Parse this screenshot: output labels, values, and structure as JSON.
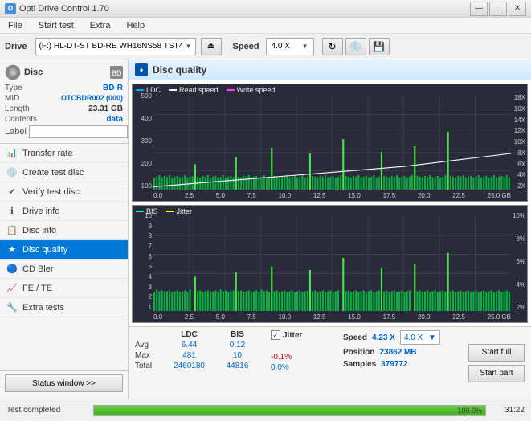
{
  "app": {
    "title": "Opti Drive Control 1.70",
    "icon_label": "O"
  },
  "title_controls": {
    "minimize": "—",
    "maximize": "□",
    "close": "✕"
  },
  "menu": {
    "items": [
      "File",
      "Start test",
      "Extra",
      "Help"
    ]
  },
  "drive_bar": {
    "drive_label": "Drive",
    "drive_value": "(F:)  HL-DT-ST BD-RE  WH16NS58 TST4",
    "speed_label": "Speed",
    "speed_value": "4.0 X"
  },
  "disc": {
    "title": "Disc",
    "type_label": "Type",
    "type_value": "BD-R",
    "mid_label": "MID",
    "mid_value": "OTCBDR002 (000)",
    "length_label": "Length",
    "length_value": "23.31 GB",
    "contents_label": "Contents",
    "contents_value": "data",
    "label_label": "Label"
  },
  "nav": {
    "items": [
      {
        "id": "transfer-rate",
        "label": "Transfer rate",
        "icon": "📊"
      },
      {
        "id": "create-test-disc",
        "label": "Create test disc",
        "icon": "💿"
      },
      {
        "id": "verify-test-disc",
        "label": "Verify test disc",
        "icon": "✔"
      },
      {
        "id": "drive-info",
        "label": "Drive info",
        "icon": "ℹ"
      },
      {
        "id": "disc-info",
        "label": "Disc info",
        "icon": "📋"
      },
      {
        "id": "disc-quality",
        "label": "Disc quality",
        "icon": "★",
        "active": true
      },
      {
        "id": "cd-bler",
        "label": "CD Bler",
        "icon": "🔵"
      },
      {
        "id": "fe-te",
        "label": "FE / TE",
        "icon": "📈"
      },
      {
        "id": "extra-tests",
        "label": "Extra tests",
        "icon": "🔧"
      }
    ]
  },
  "disc_quality": {
    "title": "Disc quality",
    "chart1": {
      "legend": [
        {
          "label": "LDC",
          "color": "#00aaff"
        },
        {
          "label": "Read speed",
          "color": "#ffffff"
        },
        {
          "label": "Write speed",
          "color": "#ff44ff"
        }
      ],
      "y_axis_right": [
        "18X",
        "16X",
        "14X",
        "12X",
        "10X",
        "8X",
        "6X",
        "4X",
        "2X"
      ],
      "y_axis_left": [
        "500",
        "400",
        "300",
        "200",
        "100"
      ],
      "x_axis": [
        "0.0",
        "2.5",
        "5.0",
        "7.5",
        "10.0",
        "12.5",
        "15.0",
        "17.5",
        "20.0",
        "22.5",
        "25.0 GB"
      ]
    },
    "chart2": {
      "legend": [
        {
          "label": "BIS",
          "color": "#00ffaa"
        },
        {
          "label": "Jitter",
          "color": "#ffff00"
        }
      ],
      "y_axis_right": [
        "10%",
        "8%",
        "6%",
        "4%",
        "2%"
      ],
      "y_axis_left": [
        "10",
        "9",
        "8",
        "7",
        "6",
        "5",
        "4",
        "3",
        "2",
        "1"
      ],
      "x_axis": [
        "0.0",
        "2.5",
        "5.0",
        "7.5",
        "10.0",
        "12.5",
        "15.0",
        "17.5",
        "20.0",
        "22.5",
        "25.0 GB"
      ]
    }
  },
  "stats": {
    "columns": [
      "LDC",
      "BIS"
    ],
    "rows": [
      {
        "label": "Avg",
        "ldc": "6.44",
        "bis": "0.12"
      },
      {
        "label": "Max",
        "ldc": "481",
        "bis": "10"
      },
      {
        "label": "Total",
        "ldc": "2460180",
        "bis": "44816"
      }
    ],
    "jitter": {
      "label": "Jitter",
      "avg": "-0.1%",
      "max": "0.0%",
      "checked": true
    },
    "speed": {
      "label": "Speed",
      "value": "4.23 X",
      "dropdown": "4.0 X"
    },
    "position": {
      "label": "Position",
      "value": "23862 MB"
    },
    "samples": {
      "label": "Samples",
      "value": "379772"
    },
    "buttons": {
      "start_full": "Start full",
      "start_part": "Start part"
    }
  },
  "status_bar": {
    "text": "Test completed",
    "progress": 100,
    "progress_label": "100.0%",
    "time": "31:22"
  }
}
